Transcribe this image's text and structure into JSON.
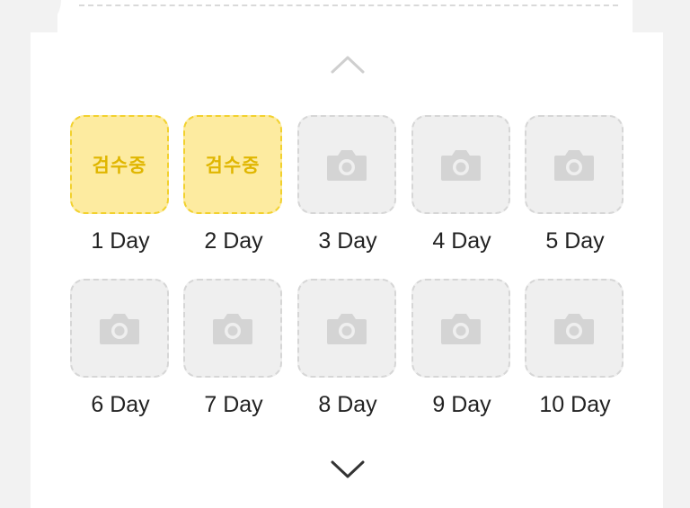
{
  "colors": {
    "pending_fill": "#fdeba0",
    "pending_border": "#f2d12e",
    "pending_text": "#e0b600",
    "empty_fill": "#efefef",
    "empty_border": "#d6d6d6",
    "label_text": "#222222"
  },
  "nav": {
    "up_icon": "chevron-up",
    "down_icon": "chevron-down"
  },
  "days": [
    {
      "label": "1 Day",
      "status": "pending",
      "status_text": "검수중"
    },
    {
      "label": "2 Day",
      "status": "pending",
      "status_text": "검수중"
    },
    {
      "label": "3 Day",
      "status": "empty",
      "icon": "camera"
    },
    {
      "label": "4 Day",
      "status": "empty",
      "icon": "camera"
    },
    {
      "label": "5 Day",
      "status": "empty",
      "icon": "camera"
    },
    {
      "label": "6 Day",
      "status": "empty",
      "icon": "camera"
    },
    {
      "label": "7 Day",
      "status": "empty",
      "icon": "camera"
    },
    {
      "label": "8 Day",
      "status": "empty",
      "icon": "camera"
    },
    {
      "label": "9 Day",
      "status": "empty",
      "icon": "camera"
    },
    {
      "label": "10 Day",
      "status": "empty",
      "icon": "camera"
    }
  ]
}
